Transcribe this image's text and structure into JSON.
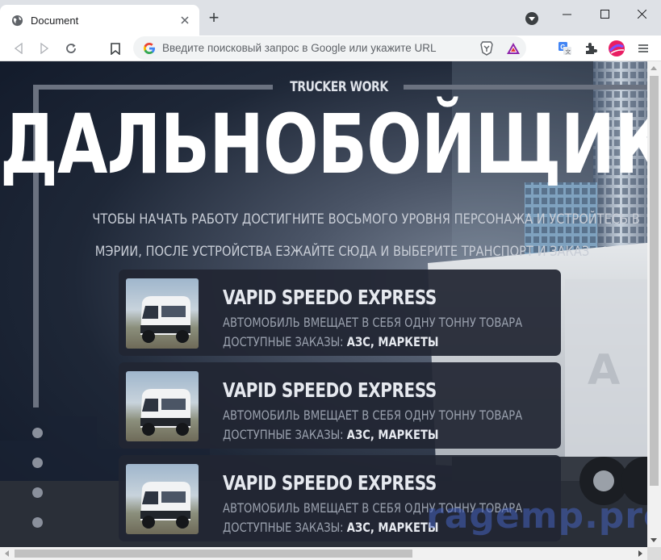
{
  "browser": {
    "tab_title": "Document",
    "new_tab_label": "+",
    "address_placeholder": "Введите поисковый запрос в Google или укажите URL"
  },
  "page": {
    "subtitle": "TRUCKER WORK",
    "title": "ДАЛЬНОБОЙЩИК",
    "description": [
      "ЧТОБЫ НАЧАТЬ РАБОТУ ДОСТИГНИТЕ ВОСЬМОГО УРОВНЯ ПЕРСОНАЖА И УСТРОЙТЕСЬ В",
      "МЭРИИ, ПОСЛЕ УСТРОЙСТВА ЕЗЖАЙТЕ СЮДА И ВЫБЕРИТЕ ТРАНСПОРТ И ЗАКАЗ"
    ],
    "vehicles": [
      {
        "name": "VAPID SPEEDO EXPRESS",
        "capacity": "АВТОМОБИЛЬ ВМЕЩАЕТ В СЕБЯ ОДНУ ТОННУ ТОВАРА",
        "orders_label": "ДОСТУПНЫЕ ЗАКАЗЫ:",
        "orders_value": "АЗС, МАРКЕТЫ"
      },
      {
        "name": "VAPID SPEEDO EXPRESS",
        "capacity": "АВТОМОБИЛЬ ВМЕЩАЕТ В СЕБЯ ОДНУ ТОННУ ТОВАРА",
        "orders_label": "ДОСТУПНЫЕ ЗАКАЗЫ:",
        "orders_value": "АЗС, МАРКЕТЫ"
      },
      {
        "name": "VAPID SPEEDO EXPRESS",
        "capacity": "АВТОМОБИЛЬ ВМЕЩАЕТ В СЕБЯ ОДНУ ТОННУ ТОВАРА",
        "orders_label": "ДОСТУПНЫЕ ЗАКАЗЫ:",
        "orders_value": "АЗС, МАРКЕТЫ"
      }
    ],
    "watermark": "ragemp.pro"
  },
  "icons": [
    "globe-icon",
    "close-icon",
    "plus-icon",
    "tab-search-icon",
    "minimize-icon",
    "maximize-icon",
    "window-close-icon",
    "back-icon",
    "forward-icon",
    "reload-icon",
    "bookmark-icon",
    "google-icon",
    "brave-shield-icon",
    "brave-rewards-icon",
    "translate-icon",
    "extensions-icon",
    "profile-icon",
    "menu-icon",
    "van-thumbnail-icon"
  ],
  "colors": {
    "page_bg": "#0f1729",
    "card_bg": "#212633",
    "accent_text": "#ffffff",
    "muted_text": "#9aa1ae",
    "watermark": "#4662be"
  }
}
